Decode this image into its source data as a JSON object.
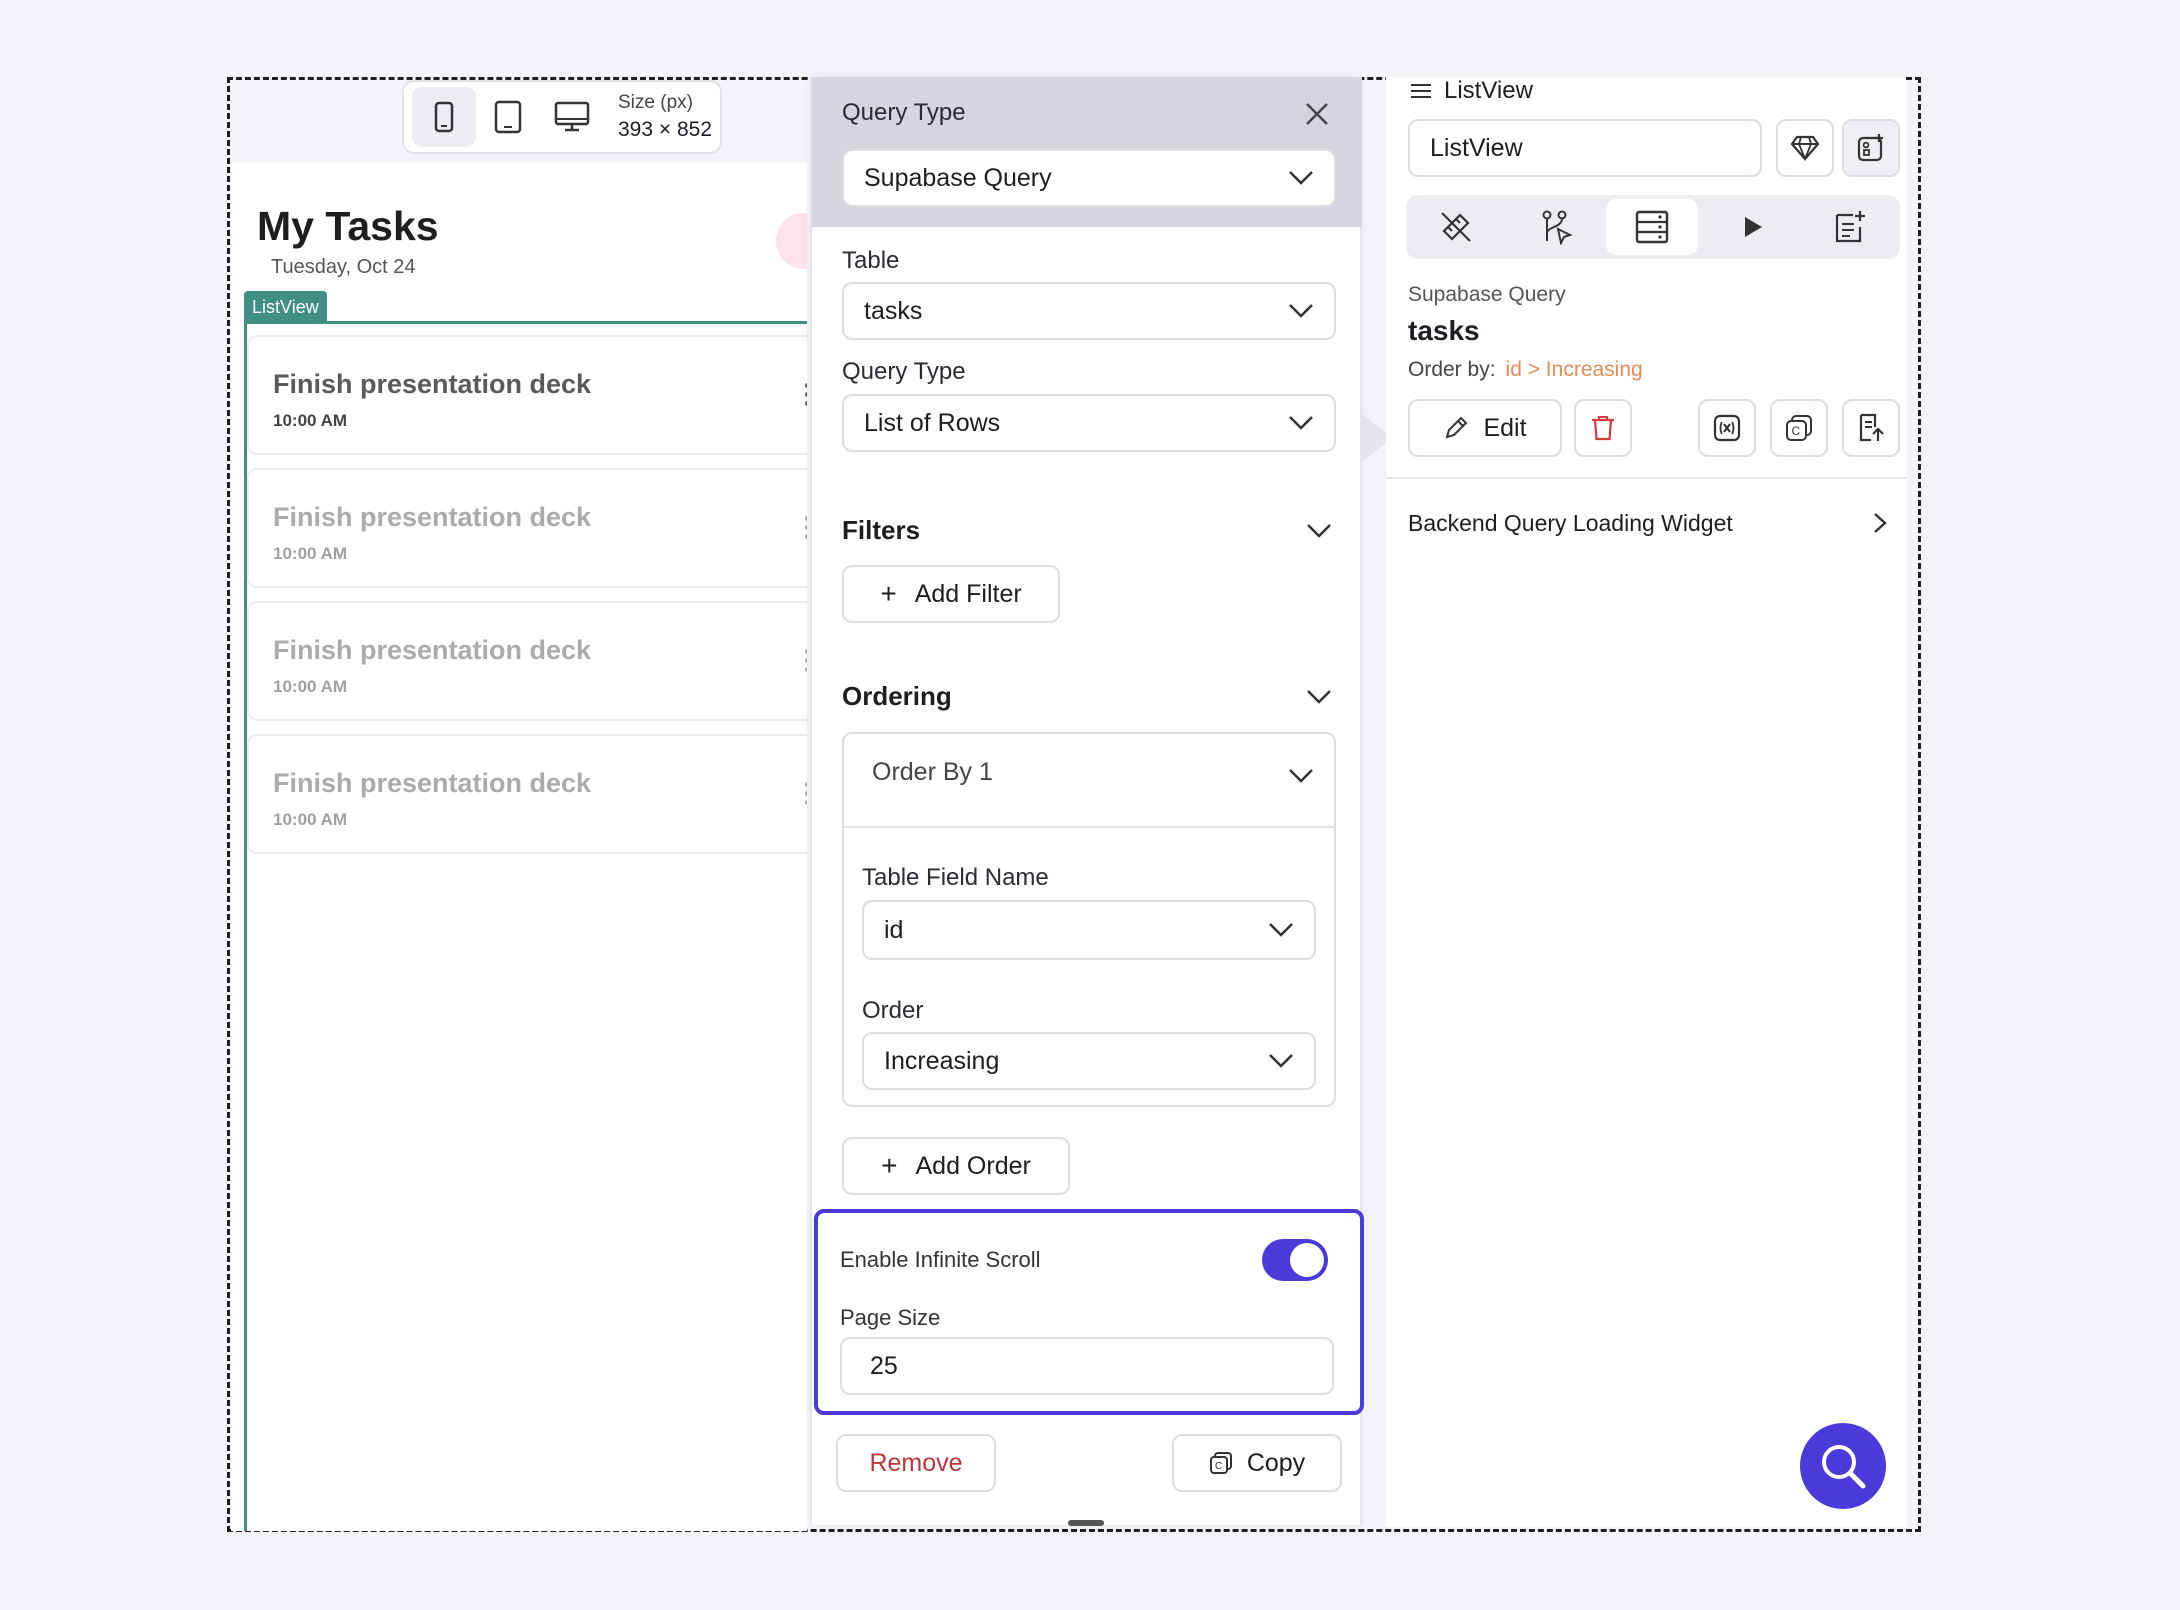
{
  "device_toolbar": {
    "size_label": "Size (px)",
    "size_value": "393 × 852",
    "devices": [
      "phone-icon",
      "tablet-icon",
      "desktop-icon"
    ],
    "active_device": "phone"
  },
  "preview": {
    "title": "My Tasks",
    "date": "Tuesday, Oct 24",
    "listview_tag": "ListView",
    "tasks": [
      {
        "title": "Finish presentation deck",
        "time": "10:00 AM"
      },
      {
        "title": "Finish presentation deck",
        "time": "10:00 AM"
      },
      {
        "title": "Finish presentation deck",
        "time": "10:00 AM"
      },
      {
        "title": "Finish presentation deck",
        "time": "10:00 AM"
      }
    ]
  },
  "query_panel": {
    "header_label": "Query Type",
    "query_type_value": "Supabase Query",
    "table_label": "Table",
    "table_value": "tasks",
    "query_type_label": "Query Type",
    "query_type_rows": "List of Rows",
    "filters_label": "Filters",
    "add_filter": "Add Filter",
    "ordering_label": "Ordering",
    "order_by_title": "Order By 1",
    "table_field_label": "Table Field Name",
    "table_field_value": "id",
    "order_label": "Order",
    "order_value": "Increasing",
    "add_order": "Add Order",
    "infinite_scroll_label": "Enable Infinite Scroll",
    "infinite_scroll_enabled": true,
    "page_size_label": "Page Size",
    "page_size_value": "25",
    "remove_label": "Remove",
    "copy_label": "Copy"
  },
  "props_panel": {
    "breadcrumb": "ListView",
    "widget_name": "ListView",
    "query_source": "Supabase Query",
    "query_table": "tasks",
    "order_by_label": "Order by:",
    "order_by_value": "id > Increasing",
    "edit_label": "Edit",
    "backend_loading_label": "Backend Query Loading Widget",
    "tabs": [
      "properties-icon",
      "actions-icon",
      "backend-query-icon",
      "play-icon",
      "notes-icon"
    ],
    "active_tab": "backend-query-icon"
  },
  "colors": {
    "accent": "#4b3ad9",
    "listview_tag": "#3f8f84",
    "order_value": "#e98a56",
    "remove": "#c2343a"
  }
}
